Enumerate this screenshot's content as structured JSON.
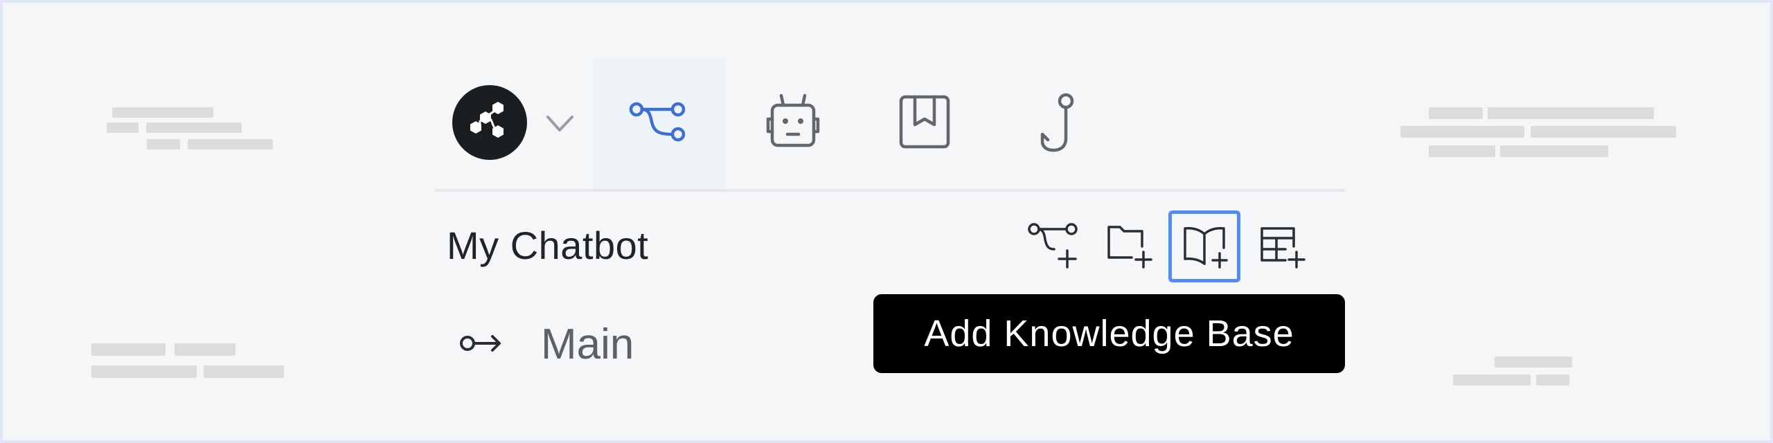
{
  "workspace": {
    "title": "My Chatbot",
    "logo_icon": "hexagon-cluster-icon",
    "switcher_icon": "chevron-down-icon"
  },
  "tabs": [
    {
      "id": "flow",
      "icon": "flow-branch-icon",
      "active": true
    },
    {
      "id": "bot",
      "icon": "robot-icon",
      "active": false
    },
    {
      "id": "library",
      "icon": "bookmark-book-icon",
      "active": false
    },
    {
      "id": "hook",
      "icon": "hook-icon",
      "active": false
    }
  ],
  "actions": [
    {
      "id": "add-flow",
      "icon": "add-flow-icon"
    },
    {
      "id": "add-folder",
      "icon": "add-folder-icon"
    },
    {
      "id": "add-knowledge-base",
      "icon": "add-book-icon",
      "selected": true
    },
    {
      "id": "add-table",
      "icon": "add-table-icon"
    }
  ],
  "flows": [
    {
      "label": "Main",
      "icon": "entry-arrow-icon"
    }
  ],
  "tooltip": {
    "text": "Add Knowledge Base"
  },
  "colors": {
    "accent": "#3b6fd4",
    "selected_border": "#4f8ef0",
    "icon_gray": "#63666b",
    "tab_active_bg": "#eef3f8"
  }
}
